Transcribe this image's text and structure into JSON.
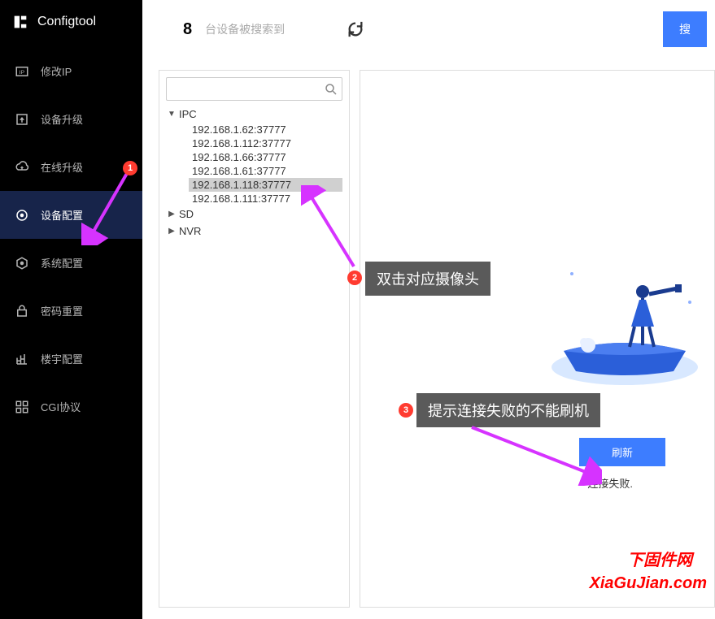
{
  "app": {
    "name": "Configtool"
  },
  "sidebar": {
    "items": [
      {
        "label": "修改IP",
        "icon": "ip-icon"
      },
      {
        "label": "设备升级",
        "icon": "upgrade-icon"
      },
      {
        "label": "在线升级",
        "icon": "online-upgrade-icon"
      },
      {
        "label": "设备配置",
        "icon": "device-config-icon",
        "active": true
      },
      {
        "label": "系统配置",
        "icon": "system-config-icon"
      },
      {
        "label": "密码重置",
        "icon": "password-reset-icon"
      },
      {
        "label": "楼宇配置",
        "icon": "building-icon"
      },
      {
        "label": "CGI协议",
        "icon": "cgi-icon"
      }
    ]
  },
  "header": {
    "count": "8",
    "count_label": "台设备被搜索到",
    "search_btn": "搜"
  },
  "tree": {
    "search_placeholder": "",
    "nodes": [
      {
        "label": "IPC",
        "expanded": true,
        "children": [
          {
            "label": "192.168.1.62:37777"
          },
          {
            "label": "192.168.1.112:37777"
          },
          {
            "label": "192.168.1.66:37777"
          },
          {
            "label": "192.168.1.61:37777"
          },
          {
            "label": "192.168.1.118:37777",
            "selected": true
          },
          {
            "label": "192.168.1.111:37777"
          }
        ]
      },
      {
        "label": "SD",
        "expanded": false
      },
      {
        "label": "NVR",
        "expanded": false
      }
    ]
  },
  "detail": {
    "refresh_label": "刷新",
    "status": "连接失败."
  },
  "annotations": {
    "tip2": "双击对应摄像头",
    "tip3": "提示连接失败的不能刷机"
  },
  "watermark": {
    "line1": "下固件网",
    "line2": "XiaGuJian.com"
  }
}
